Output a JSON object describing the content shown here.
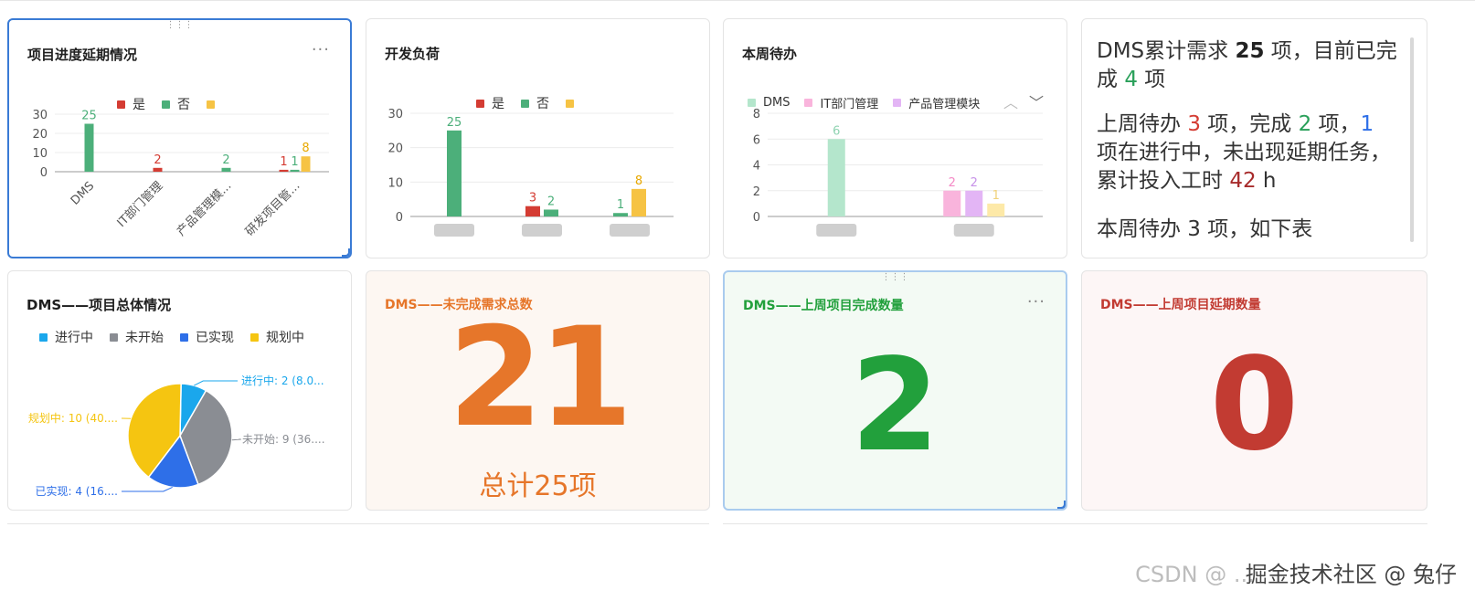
{
  "cards": {
    "delay": {
      "title": "项目进度延期情况",
      "legend": [
        {
          "label": "是",
          "color": "#d43c33"
        },
        {
          "label": "否",
          "color": "#4caf7a"
        },
        {
          "label": "",
          "color": "#f6c344"
        }
      ],
      "chart_data": {
        "type": "bar",
        "categories": [
          "DMS",
          "IT部门管理",
          "产品管理模...",
          "研发项目管..."
        ],
        "series": [
          {
            "name": "是",
            "values": [
              null,
              2,
              null,
              1
            ]
          },
          {
            "name": "否",
            "values": [
              25,
              null,
              2,
              1
            ]
          },
          {
            "name": "",
            "values": [
              null,
              null,
              null,
              8
            ]
          }
        ],
        "yticks": [
          0,
          10,
          20,
          30
        ],
        "ylim": [
          0,
          30
        ]
      }
    },
    "dev_load": {
      "title": "开发负荷",
      "legend": [
        {
          "label": "是",
          "color": "#d43c33"
        },
        {
          "label": "否",
          "color": "#4caf7a"
        },
        {
          "label": "",
          "color": "#f6c344"
        }
      ],
      "chart_data": {
        "type": "bar",
        "categories": [
          "",
          "",
          ""
        ],
        "series": [
          {
            "name": "是",
            "values": [
              null,
              3,
              null
            ]
          },
          {
            "name": "否",
            "values": [
              25,
              2,
              1
            ]
          },
          {
            "name": "",
            "values": [
              null,
              null,
              8
            ]
          }
        ],
        "yticks": [
          0,
          10,
          20,
          30
        ],
        "ylim": [
          0,
          30
        ]
      }
    },
    "weekly_todo": {
      "title": "本周待办",
      "legend": [
        {
          "label": "DMS",
          "color": "#b4e6cc"
        },
        {
          "label": "IT部门管理",
          "color": "#f9b4dc"
        },
        {
          "label": "产品管理模块",
          "color": "#e3b5f5"
        }
      ],
      "chart_data": {
        "type": "bar",
        "categories": [
          "",
          ""
        ],
        "series": [
          {
            "name": "DMS",
            "values": [
              6,
              null
            ]
          },
          {
            "name": "IT部门管理",
            "values": [
              null,
              2
            ]
          },
          {
            "name": "产品管理模块",
            "values": [
              null,
              2
            ]
          },
          {
            "name": "",
            "values": [
              null,
              1
            ]
          }
        ],
        "yticks": [
          0,
          2,
          4,
          6,
          8
        ],
        "ylim": [
          0,
          8
        ]
      }
    },
    "summary": {
      "p1": {
        "a": "DMS累计需求 ",
        "b": "25",
        "c": " 项，目前已完成 ",
        "d": "4",
        "e": " 项"
      },
      "p2": {
        "a": "上周待办 ",
        "b": "3",
        "c": " 项，完成 ",
        "d": "2",
        "e": " 项，",
        "f": "1",
        "g": " 项在进行中，未出现延期任务，累计投入工时 ",
        "h": "42",
        "i": " h"
      },
      "p3": "本周待办 3 项，如下表"
    },
    "overall": {
      "title": "DMS——项目总体情况",
      "legend": [
        {
          "label": "进行中",
          "color": "#1aa7ec"
        },
        {
          "label": "未开始",
          "color": "#8a8d93"
        },
        {
          "label": "已实现",
          "color": "#2e6fe8"
        },
        {
          "label": "规划中",
          "color": "#f5c511"
        }
      ],
      "chart_data": {
        "type": "pie",
        "slices": [
          {
            "name": "进行中",
            "value": 2,
            "label": "进行中: 2 (8.0...",
            "color": "#1aa7ec"
          },
          {
            "name": "未开始",
            "value": 9,
            "label": "未开始: 9 (36....",
            "color": "#8a8d93"
          },
          {
            "name": "已实现",
            "value": 4,
            "label": "已实现: 4 (16....",
            "color": "#2e6fe8"
          },
          {
            "name": "规划中",
            "value": 10,
            "label": "规划中: 10 (40....",
            "color": "#f5c511"
          }
        ]
      }
    },
    "incomplete": {
      "title": "DMS——未完成需求总数",
      "value": "21",
      "total": "总计25项",
      "color": "#e6762a"
    },
    "completed": {
      "title": "DMS——上周项目完成数量",
      "value": "2",
      "color": "#22a03c"
    },
    "delayed": {
      "title": "DMS——上周项目延期数量",
      "value": "0",
      "color": "#c23b32"
    }
  },
  "icons": {
    "more": "more-icon",
    "drag": "drag-handle-icon",
    "resize": "resize-handle-icon",
    "chevron_up": "chevron-up-icon",
    "chevron_down": "chevron-down-icon"
  },
  "watermark": {
    "ghost": "CSDN @ ...",
    "text": "掘金技术社区 @ 兔仔"
  }
}
